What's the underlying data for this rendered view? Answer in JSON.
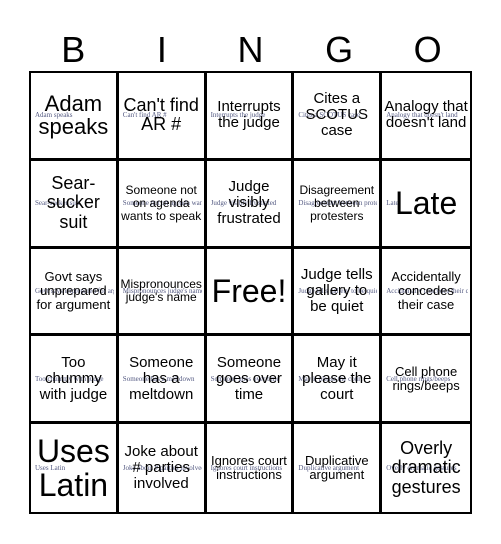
{
  "header": {
    "letters": [
      "B",
      "I",
      "N",
      "G",
      "O"
    ]
  },
  "cells": [
    {
      "text": "Adam speaks",
      "label": "Adam speaks"
    },
    {
      "text": "Can't find AR #",
      "label": "Can't find AR #"
    },
    {
      "text": "Interrupts the judge",
      "label": "Interrupts the judge"
    },
    {
      "text": "Cites a SCOTUS case",
      "label": "Cites a SCOTUS case"
    },
    {
      "text": "Analogy that doesn't land",
      "label": "Analogy that doesn't land"
    },
    {
      "text": "Sear-sucker suit",
      "label": "Sear-sucker suit"
    },
    {
      "text": "Someone not on agenda wants to speak",
      "label": "Someone not on agenda wants to speak"
    },
    {
      "text": "Judge visibly frustrated",
      "label": "Judge visibly frustrated"
    },
    {
      "text": "Disagreement between protesters",
      "label": "Disagreement between protesters"
    },
    {
      "text": "Late",
      "label": "Late"
    },
    {
      "text": "Govt says unprepared for argument",
      "label": "Govt says unprepared for argument"
    },
    {
      "text": "Mispronounces judge's name",
      "label": "Mispronounces judge's name"
    },
    {
      "text": "Free!",
      "label": ""
    },
    {
      "text": "Judge tells gallery to be quiet",
      "label": "Judge tells gallery to be quiet"
    },
    {
      "text": "Accidentally concedes their case",
      "label": "Accidentally concedes their case"
    },
    {
      "text": "Too chummy with judge",
      "label": "Too chummy with judge"
    },
    {
      "text": "Someone has a meltdown",
      "label": "Someone has a meltdown"
    },
    {
      "text": "Someone goes over time",
      "label": "Someone goes over time"
    },
    {
      "text": "May it please the court",
      "label": "May it please the court"
    },
    {
      "text": "Cell phone rings/beeps",
      "label": "Cell phone rings/beeps"
    },
    {
      "text": "Uses Latin",
      "label": "Uses Latin"
    },
    {
      "text": "Joke about # parties involved",
      "label": "Joke about # parties involved"
    },
    {
      "text": "Ignores court instructions",
      "label": "Ignores court instructions"
    },
    {
      "text": "Duplicative argument",
      "label": "Duplicative argument"
    },
    {
      "text": "Overly dramatic gestures",
      "label": "Overly dramatic gestures"
    }
  ]
}
